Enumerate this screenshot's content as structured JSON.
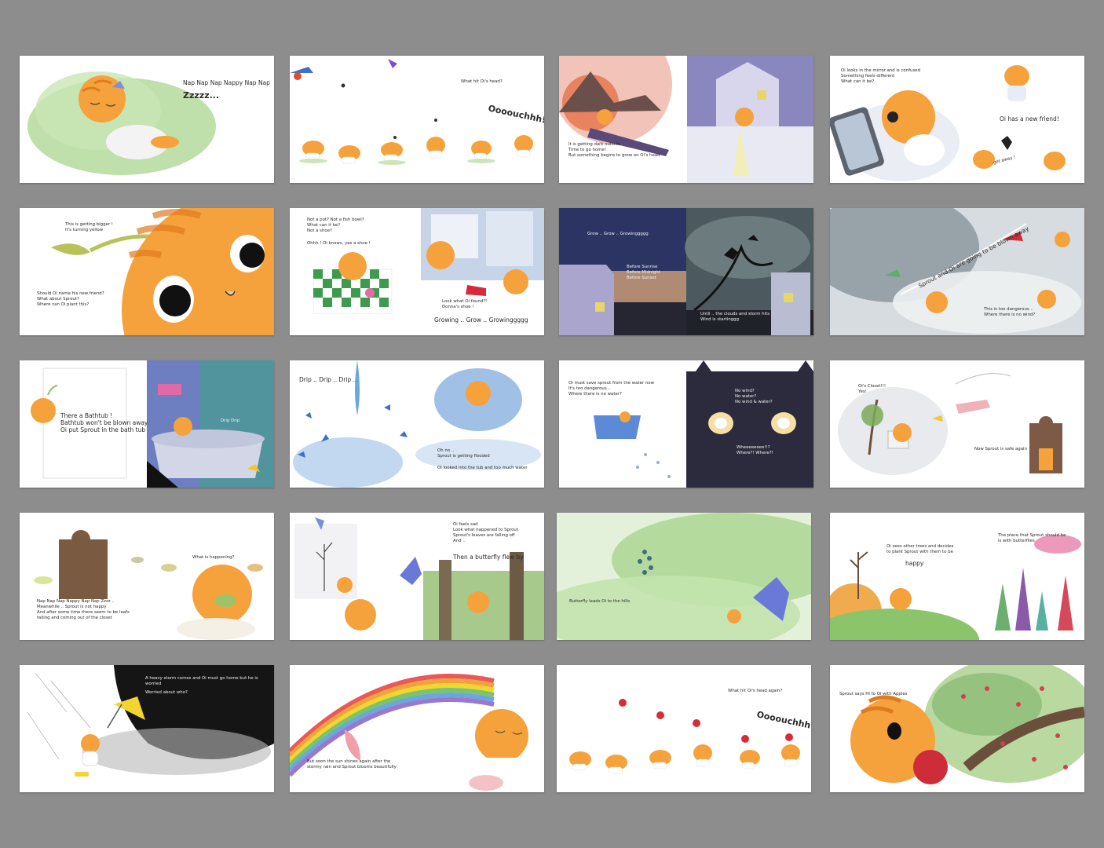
{
  "book": {
    "spreads": [
      {
        "texts": [
          "Nap Nap Nap Nappy Nap Nap",
          "Zzzzz..."
        ]
      },
      {
        "texts": [
          "What hit Oi's head?",
          "Oooouchhh!"
        ]
      },
      {
        "texts": [
          "It is getting dark outside\nTime to go home!\nBut something begins to grow on Oi's head"
        ]
      },
      {
        "texts": [
          "Oi looks in the mirror and is confused\nSomething feels different\nWhat can it be?",
          "Oi has a new friend!",
          "get away !"
        ]
      },
      {
        "texts": [
          "This is getting bigger !\nIt's turning yellow",
          "Should Oi name his new friend?\nWhat about Sprout?\nWhere can Oi plant this?"
        ]
      },
      {
        "texts": [
          "Not a pot? Not a fish bowl?\nWhat can it be?\nNot a shoe?",
          "Ohhh ! Oi knows, yes a shoe !",
          "Look what Oi found?!\nDonna's shoe !",
          "Growing .. Grow .. Growinggggg"
        ]
      },
      {
        "texts": [
          "Grow .. Grow .. Growinggggg",
          "Before Sunrise\nBefore Midnight\nBefore Sunset",
          "Until .. the clouds and storm hits\nWind is startinggg"
        ]
      },
      {
        "texts": [
          "Sprout and Oi are going to be blown away",
          "This is too dangerous ..\nWhere there is no wind?"
        ]
      },
      {
        "texts": [
          "There a Bathtub !\nBathtub won't be blown away\nOi put Sprout in the bath tub",
          "Drip Drip"
        ]
      },
      {
        "texts": [
          "Drip .. Drip .. Drip ..",
          "Oh no ..\nSprout is getting flooded",
          "Oi looked into the tub and too much water"
        ]
      },
      {
        "texts": [
          "Oi must save sprout from the water now\nIt's too dangerous ..\nWhere there is no water?",
          "No wind?\nNo water?\nNo wind & water?",
          "Wheeeeeeee!!?\nWhere?! Where?!"
        ]
      },
      {
        "texts": [
          "Oi's Closet!!!\nYes!",
          "Now Sprout is safe again"
        ]
      },
      {
        "texts": [
          "What is happening?",
          "Nap Nap Nap Nappy Nap Nap Zzzz ..\nMeanwhile .. Sprout is not happy\nAnd after some time there seem to be leafs\nfalling and coming out of the closet"
        ]
      },
      {
        "texts": [
          "Oi feels sad\nLook what happened to Sprout\nSprout's leaves are falling off\nAnd ..",
          "Then a butterfly flew by"
        ]
      },
      {
        "texts": [
          "Butterfly leads Oi to the hills"
        ]
      },
      {
        "texts": [
          "Oi sees other trees and decides\nto plant Sprout with them to be",
          "happy",
          "The place that Sprout should be\nis with butterflies"
        ]
      },
      {
        "texts": [
          "A heavy storm comes and Oi must go home but he is worried",
          "Worried about who?"
        ]
      },
      {
        "texts": [
          "But soon the sun shines again after the\nstormy rain and Sprout blooms beautifully"
        ]
      },
      {
        "texts": [
          "What hit Oi's head again?",
          "Oooouchhh!"
        ]
      },
      {
        "texts": [
          "Sprout says Hi to Oi with Apples"
        ]
      }
    ]
  },
  "colors": {
    "background": "#8d8d8d",
    "page": "#ffffff",
    "cat": "#f5a23c",
    "cat_stripe": "#e07a1f",
    "leaf": "#8fc46b"
  }
}
